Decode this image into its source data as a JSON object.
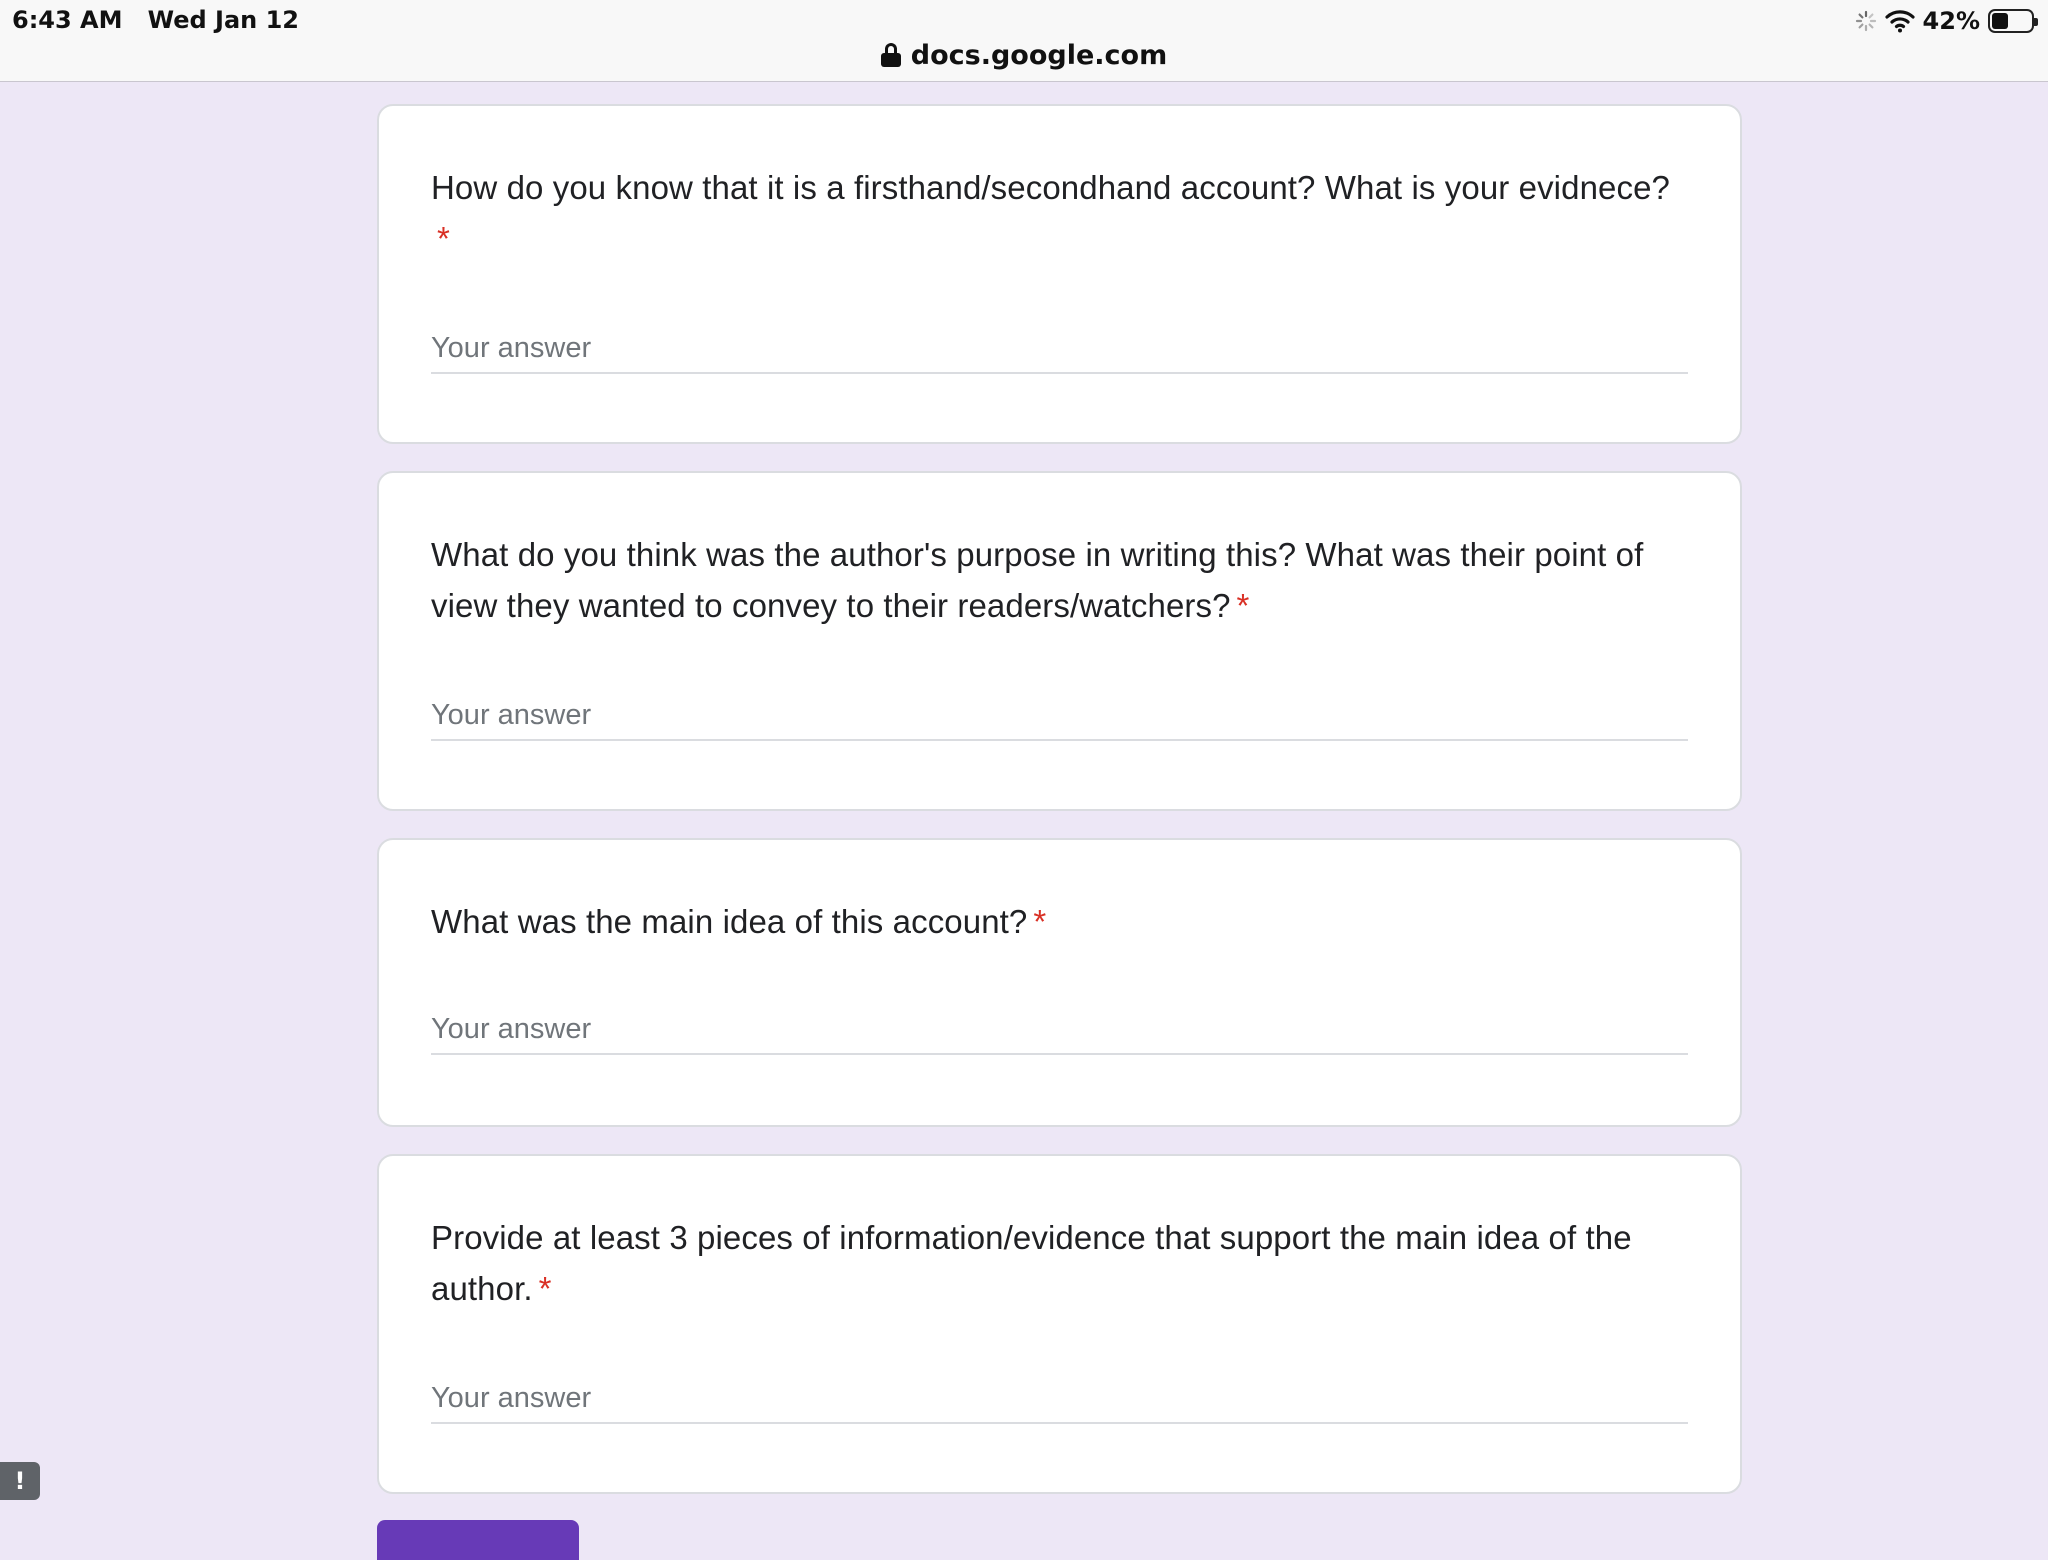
{
  "status_bar": {
    "time": "6:43 AM",
    "date": "Wed Jan 12",
    "battery": "42%",
    "battery_level": 0.42,
    "icons": [
      "loading-spinner-icon",
      "wifi-icon",
      "battery-icon"
    ]
  },
  "browser": {
    "url": "docs.google.com",
    "secure_icon": "lock-icon"
  },
  "questions": [
    {
      "text": "How do you know that it is a firsthand/secondhand account? What is your evidnece?",
      "required_marker": "*",
      "placeholder": "Your answer"
    },
    {
      "text": "What do you think was the author's purpose in writing this? What was their point of view they wanted to convey to their readers/watchers?",
      "required_marker": "*",
      "placeholder": "Your answer"
    },
    {
      "text": "What was the main idea of this account?",
      "required_marker": "*",
      "placeholder": "Your answer"
    },
    {
      "text": "Provide at least 3 pieces of information/evidence that support the main idea of the author.",
      "required_marker": "*",
      "placeholder": "Your answer"
    }
  ],
  "report_button": {
    "label": "!"
  },
  "colors": {
    "page_background": "#ede7f6",
    "card_background": "#ffffff",
    "accent": "#673ab7",
    "required": "#d93025",
    "placeholder": "#70757a"
  }
}
